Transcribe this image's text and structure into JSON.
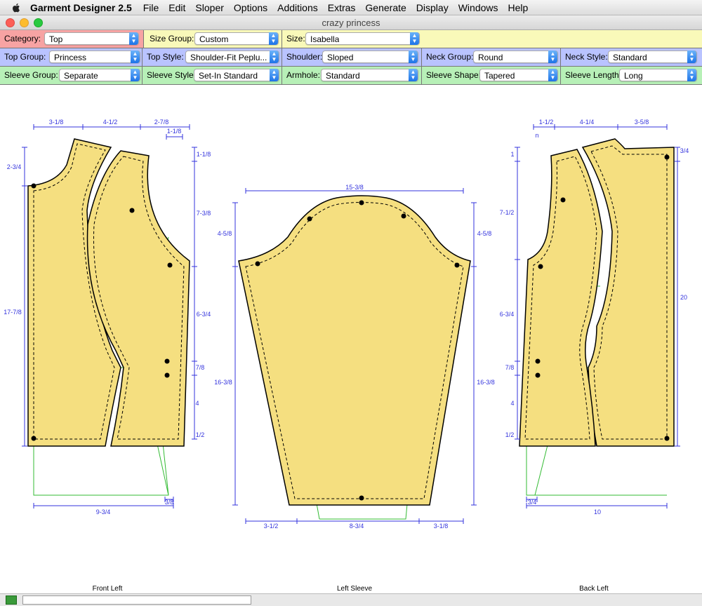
{
  "menubar": {
    "app_name": "Garment Designer 2.5",
    "items": [
      "File",
      "Edit",
      "Sloper",
      "Options",
      "Additions",
      "Extras",
      "Generate",
      "Display",
      "Windows",
      "Help"
    ]
  },
  "window": {
    "title": "crazy princess"
  },
  "colors": {
    "row1": "#f9f9b9",
    "row1_label_bg": "#f7a3a3",
    "row2": "#b9c3ff",
    "row3": "#b7f0b7",
    "piece_fill": "#f5df80",
    "dimension": "#3333dd",
    "guide": "#33bb33"
  },
  "row1": {
    "category": {
      "label": "Category:",
      "value": "Top"
    },
    "size_group": {
      "label": "Size Group:",
      "value": "Custom"
    },
    "size": {
      "label": "Size:",
      "value": "Isabella"
    }
  },
  "row2": {
    "top_group": {
      "label": "Top Group:",
      "value": "Princess"
    },
    "top_style": {
      "label": "Top Style:",
      "value": "Shoulder-Fit Peplu..."
    },
    "shoulder": {
      "label": "Shoulder:",
      "value": "Sloped"
    },
    "neck_group": {
      "label": "Neck Group:",
      "value": "Round"
    },
    "neck_style": {
      "label": "Neck Style:",
      "value": "Standard"
    }
  },
  "row3": {
    "sleeve_group": {
      "label": "Sleeve Group:",
      "value": "Separate"
    },
    "sleeve_style": {
      "label": "Sleeve Style:",
      "value": "Set-In Standard"
    },
    "armhole": {
      "label": "Armhole:",
      "value": "Standard"
    },
    "sleeve_shape": {
      "label": "Sleeve Shape:",
      "value": "Tapered"
    },
    "sleeve_length": {
      "label": "Sleeve Length:",
      "value": "Long"
    }
  },
  "captions": {
    "front": "Front Left",
    "sleeve": "Left Sleeve",
    "back": "Back Left"
  },
  "dims": {
    "front": {
      "top1": "3-1/8",
      "top2": "4-1/2",
      "top3": "2-7/8",
      "top4": "1-1/8",
      "l1": "2-3/4",
      "l2": "17-7/8",
      "r1": "1-1/8",
      "r2": "7-3/8",
      "r3": "6-3/4",
      "r4": "7/8",
      "r5": "4",
      "r6": "1/2",
      "b1": "3/8",
      "b2": "9-3/4"
    },
    "sleeve": {
      "top": "15-3/8",
      "l1": "4-5/8",
      "l2": "16-3/8",
      "r1": "4-5/8",
      "r2": "16-3/8",
      "b1": "3-1/2",
      "b2": "8-3/4",
      "b3": "3-1/8"
    },
    "back": {
      "top1": "1-1/2",
      "top2": "4-1/4",
      "top3": "3-5/8",
      "n": "n",
      "l1": "1",
      "l2": "7-1/2",
      "l3": "6-3/4",
      "l4": "7/8",
      "l5": "4",
      "l6": "1/2",
      "r1": "3/4",
      "r2": "20",
      "b1": "3/4",
      "b2": "10"
    }
  }
}
